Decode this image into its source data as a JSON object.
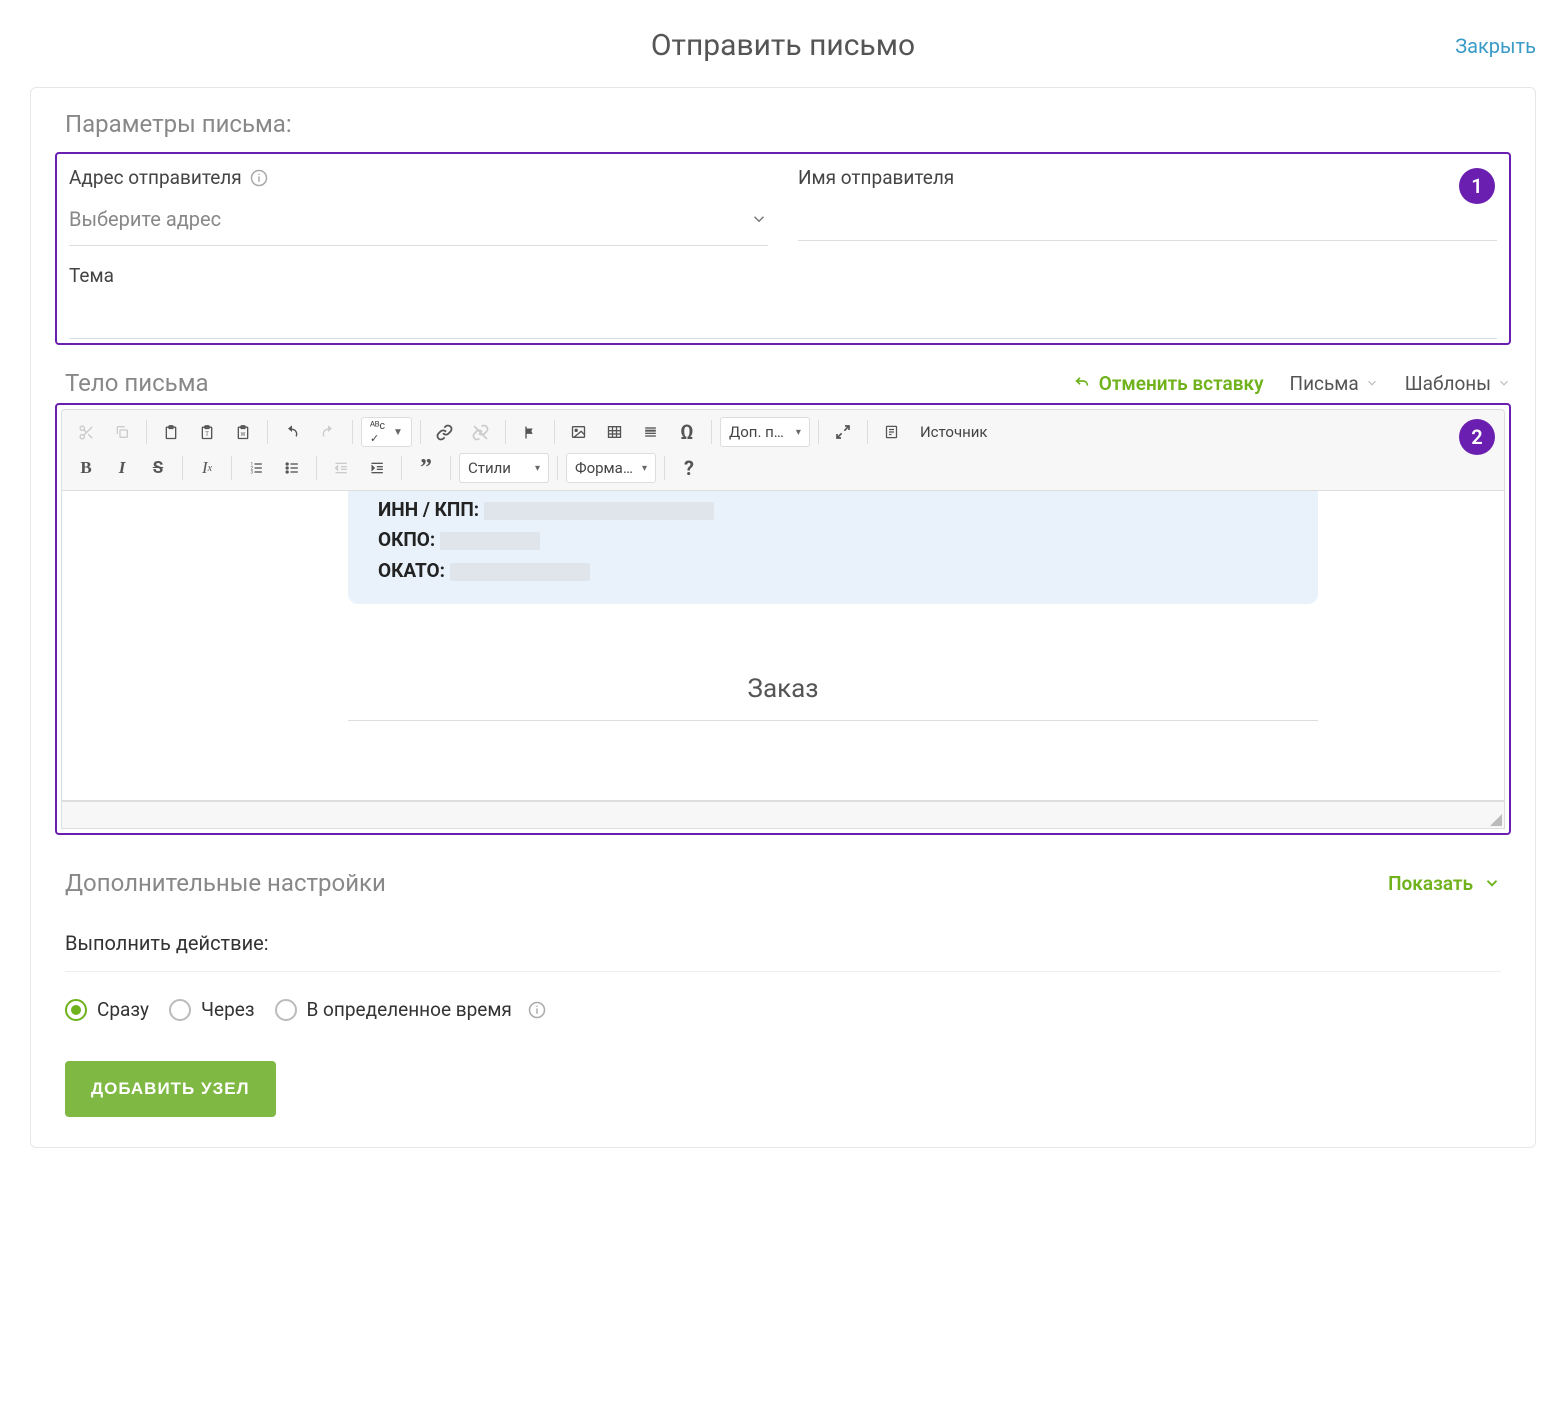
{
  "header": {
    "title": "Отправить письмо",
    "close": "Закрыть"
  },
  "params": {
    "section_title": "Параметры письма:",
    "sender_address_label": "Адрес отправителя",
    "sender_address_placeholder": "Выберите адрес",
    "sender_name_label": "Имя отправителя",
    "subject_label": "Тема",
    "badge": "1"
  },
  "body": {
    "section_title": "Тело письма",
    "undo_insert": "Отменить вставку",
    "letters_dropdown": "Письма",
    "templates_dropdown": "Шаблоны",
    "badge": "2",
    "toolbar": {
      "extra_combo": "Доп. п…",
      "source": "Источник",
      "styles": "Стили",
      "format": "Форма…"
    },
    "content": {
      "inn_label": "ИНН / КПП:",
      "okpo_label": "ОКПО:",
      "okato_label": "ОКАТО:",
      "order_heading": "Заказ"
    }
  },
  "extra": {
    "title": "Дополнительные настройки",
    "show": "Показать"
  },
  "action": {
    "title": "Выполнить действие:",
    "options": {
      "immediately": "Сразу",
      "after": "Через",
      "at_time": "В определенное время"
    }
  },
  "submit": "ДОБАВИТЬ УЗЕЛ"
}
